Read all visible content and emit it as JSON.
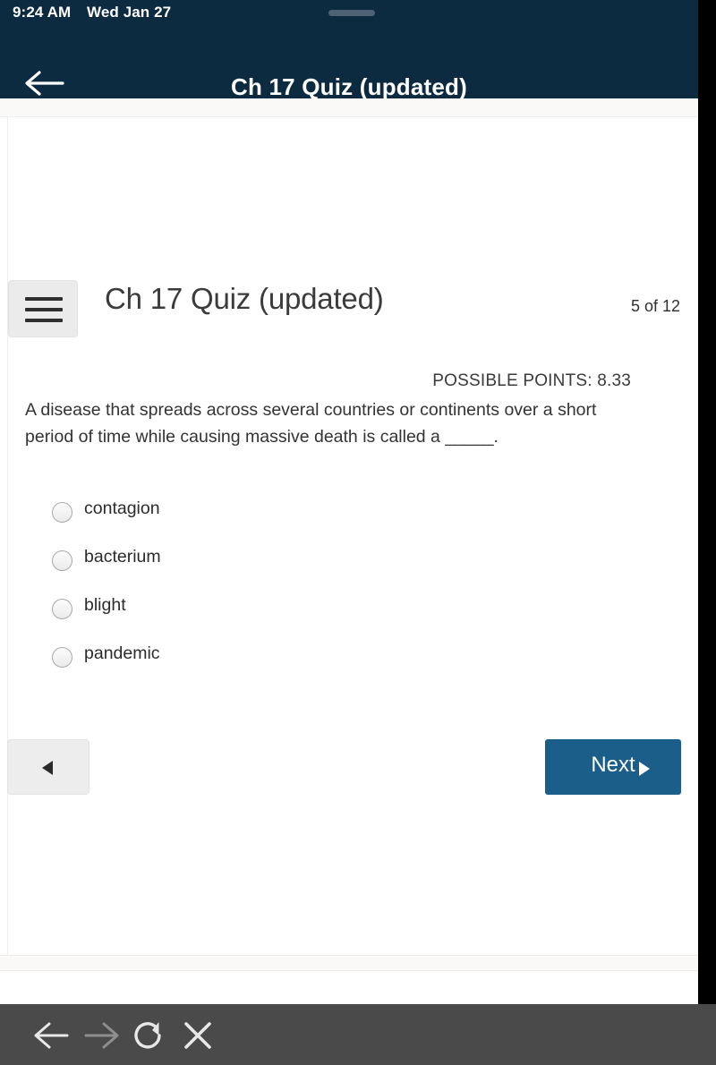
{
  "status_bar": {
    "time": "9:24 AM",
    "date": "Wed Jan 27",
    "drag_handle_icon": "drag-handle-icon"
  },
  "app_bar": {
    "back_icon": "back-arrow-icon",
    "title": "Ch 17 Quiz (updated)",
    "background_color": "#0c2a40"
  },
  "quiz": {
    "menu_icon": "hamburger-menu-icon",
    "title": "Ch 17 Quiz (updated)",
    "progress": "5 of 12",
    "possible_points": "POSSIBLE POINTS: 8.33",
    "question": "A disease that spreads across several countries or continents over a short period of time while causing massive death is called a _____.",
    "options": [
      {
        "label": "contagion",
        "selected": false
      },
      {
        "label": "bacterium",
        "selected": false
      },
      {
        "label": "blight",
        "selected": false
      },
      {
        "label": "pandemic",
        "selected": false
      }
    ],
    "prev_button": {
      "icon": "triangle-left-icon",
      "label": ""
    },
    "next_button": {
      "label": "Next",
      "icon": "triangle-right-icon",
      "color": "#1b5e8a"
    }
  },
  "scrollbar": {
    "thumb_icon": "scroll-thumb"
  },
  "browser_toolbar": {
    "background_color": "#4a4a4a",
    "buttons": [
      {
        "name": "back-icon",
        "enabled": true
      },
      {
        "name": "forward-icon",
        "enabled": false
      },
      {
        "name": "reload-icon",
        "enabled": true
      },
      {
        "name": "close-icon",
        "enabled": true
      }
    ]
  }
}
